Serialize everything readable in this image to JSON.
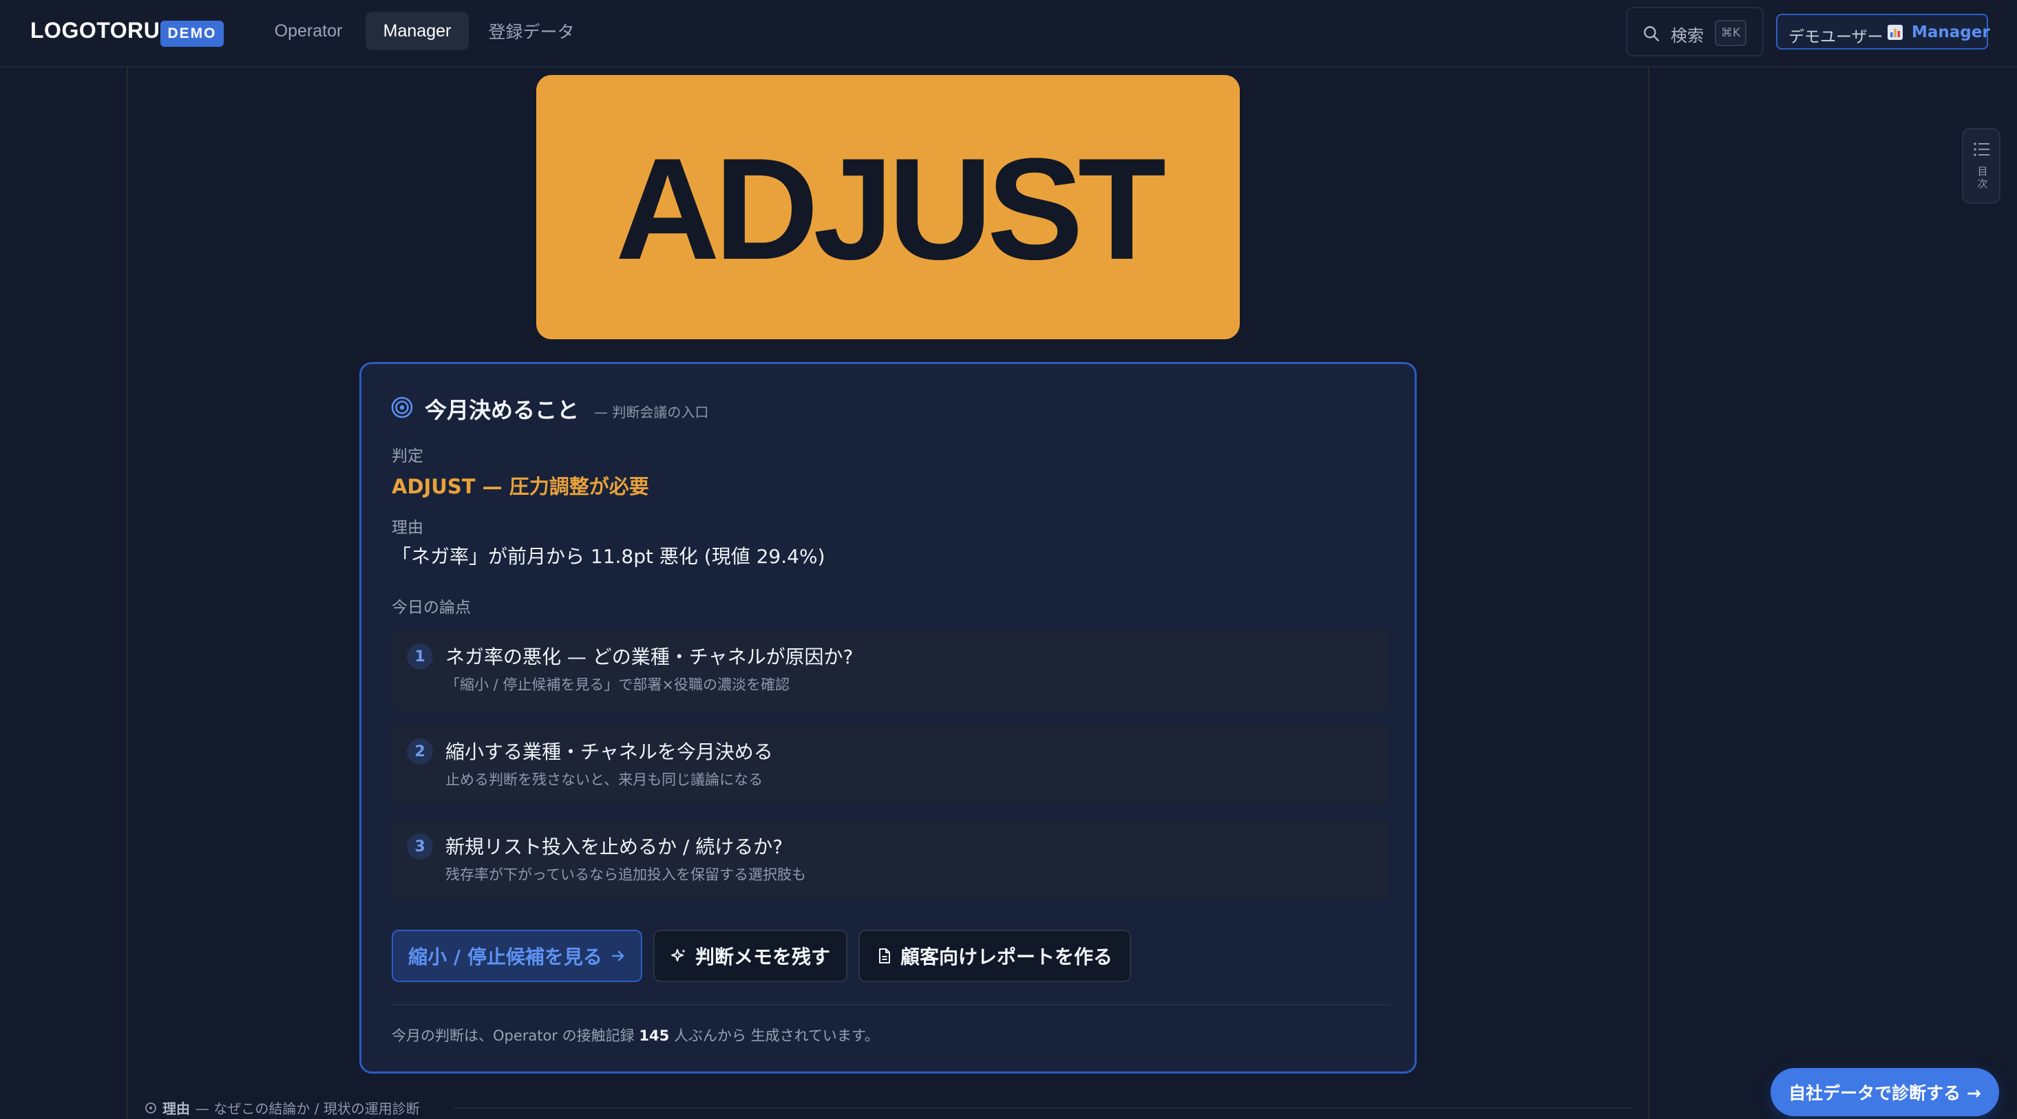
{
  "header": {
    "logo": "LOGOTORU",
    "badge": "DEMO",
    "tabs": [
      {
        "label": "Operator",
        "active": false
      },
      {
        "label": "Manager",
        "active": true
      },
      {
        "label": "登録データ",
        "active": false
      }
    ],
    "search": {
      "label": "検索",
      "shortcut": "⌘K",
      "icon": "search-icon"
    },
    "user": {
      "name": "デモユーザー",
      "icon": "bar-chart-icon",
      "role": "Manager"
    }
  },
  "verdict_banner": {
    "text": "ADJUST",
    "color": "#e9a23b"
  },
  "decision_card": {
    "icon": "target-icon",
    "title": "今月決めること",
    "subtitle": "— 判断会議の入口",
    "verdict_label": "判定",
    "verdict_value": "ADJUST — 圧力調整が必要",
    "reason_label": "理由",
    "reason_value": "「ネガ率」が前月から 11.8pt 悪化 (現値 29.4%)",
    "points_label": "今日の論点",
    "points": [
      {
        "num": "1",
        "title": "ネガ率の悪化 — どの業種・チャネルが原因か?",
        "sub": "「縮小 / 停止候補を見る」で部署×役職の濃淡を確認"
      },
      {
        "num": "2",
        "title": "縮小する業種・チャネルを今月決める",
        "sub": "止める判断を残さないと、来月も同じ議論になる"
      },
      {
        "num": "3",
        "title": "新規リスト投入を止めるか / 続けるか?",
        "sub": "残存率が下がっているなら追加投入を保留する選択肢も"
      }
    ],
    "buttons": {
      "primary": "縮小 / 停止候補を見る",
      "memo": "判断メモを残す",
      "report": "顧客向けレポートを作る"
    },
    "footnote": {
      "prefix": "今月の判断は、Operator の接触記録",
      "count": "145",
      "suffix": "人ぶんから 生成されています。"
    }
  },
  "toc": {
    "label": "目次",
    "icon": "list-icon"
  },
  "bottom_section": {
    "title": "理由",
    "rest": "— なぜこの結論か / 現状の運用診断"
  },
  "cta": "自社データで診断する →",
  "colors": {
    "background": "#121a2c",
    "accent": "#3f79e6",
    "verdict": "#e9a23b"
  }
}
